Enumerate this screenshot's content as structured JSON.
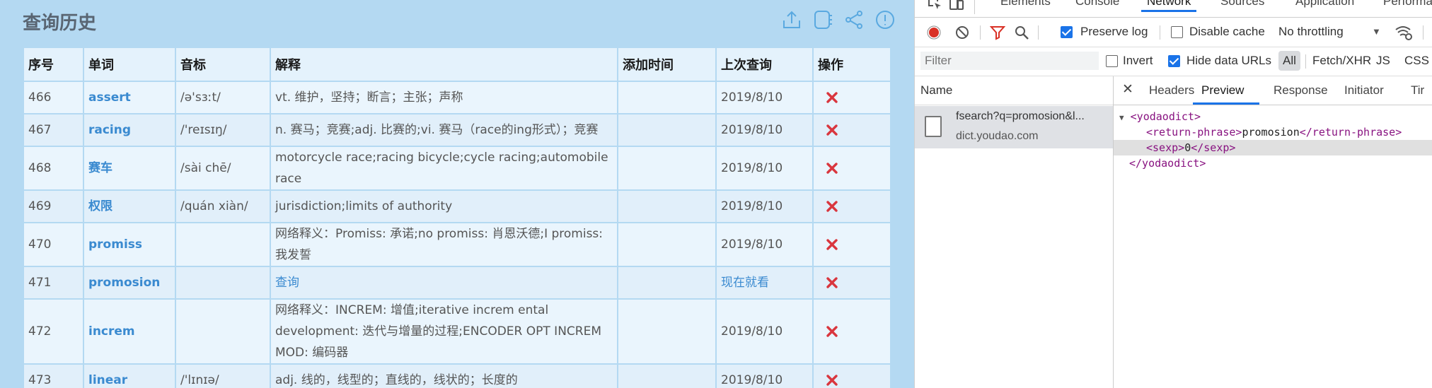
{
  "history": {
    "title": "查询历史",
    "icons": [
      "export-icon",
      "notebook-icon",
      "share-icon",
      "info-icon"
    ],
    "columns": [
      "序号",
      "单词",
      "音标",
      "解释",
      "添加时间",
      "上次查询",
      "操作"
    ],
    "rows": [
      {
        "id": "466",
        "word": "assert",
        "phonetic": "/ə'sɜːt/",
        "definition": "vt. 维护，坚持；断言；主张；声称",
        "added": "",
        "last": "2019/8/10"
      },
      {
        "id": "467",
        "word": "racing",
        "phonetic": "/'reɪsɪŋ/",
        "definition": "n. 赛马；竞赛;adj. 比赛的;vi. 赛马（race的ing形式）；竞赛",
        "added": "",
        "last": "2019/8/10"
      },
      {
        "id": "468",
        "word": "赛车",
        "phonetic": "/sài chē/",
        "definition": "motorcycle race;racing bicycle;cycle racing;automobile race",
        "added": "",
        "last": "2019/8/10"
      },
      {
        "id": "469",
        "word": "权限",
        "phonetic": "/quán xiàn/",
        "definition": "jurisdiction;limits of authority",
        "added": "",
        "last": "2019/8/10"
      },
      {
        "id": "470",
        "word": "promiss",
        "phonetic": "",
        "definition": "网络释义：Promiss: 承诺;no promiss: 肖恩沃德;I promiss: 我发誓",
        "added": "",
        "last": "2019/8/10"
      },
      {
        "id": "471",
        "word": "promosion",
        "phonetic": "",
        "definition": "查询",
        "added": "",
        "last": "现在就看",
        "link": true
      },
      {
        "id": "472",
        "word": "increm",
        "phonetic": "",
        "definition": "网络释义：INCREM: 增值;iterative increm ental development: 迭代与增量的过程;ENCODER OPT INCREM MOD: 编码器",
        "added": "",
        "last": "2019/8/10"
      },
      {
        "id": "473",
        "word": "linear",
        "phonetic": "/'lɪnɪə/",
        "definition": "adj. 线的，线型的；直线的，线状的；长度的",
        "added": "",
        "last": "2019/8/10"
      }
    ]
  },
  "devtools": {
    "tabs": [
      "Elements",
      "Console",
      "Network",
      "Sources",
      "Application",
      "Performar"
    ],
    "active_tab": "Network",
    "toolbar": {
      "preserve_log": "Preserve log",
      "disable_cache": "Disable cache",
      "throttling": "No throttling"
    },
    "filterbar": {
      "placeholder": "Filter",
      "invert": "Invert",
      "hide_data_urls": "Hide data URLs",
      "types": [
        "All",
        "Fetch/XHR",
        "JS",
        "CSS"
      ]
    },
    "name_header": "Name",
    "request": {
      "name": "fsearch?q=promosion&l...",
      "domain": "dict.youdao.com"
    },
    "detail_tabs": [
      "Headers",
      "Preview",
      "Response",
      "Initiator",
      "Tir"
    ],
    "active_detail_tab": "Preview",
    "preview": {
      "open_tag": "<yodaodict>",
      "phrase_open": "<return-phrase>",
      "phrase_value": "promosion",
      "phrase_close": "</return-phrase>",
      "sexp_open": "<sexp>",
      "sexp_value": "0",
      "sexp_close": "</sexp>",
      "close_tag": "</yodaodict>"
    }
  }
}
